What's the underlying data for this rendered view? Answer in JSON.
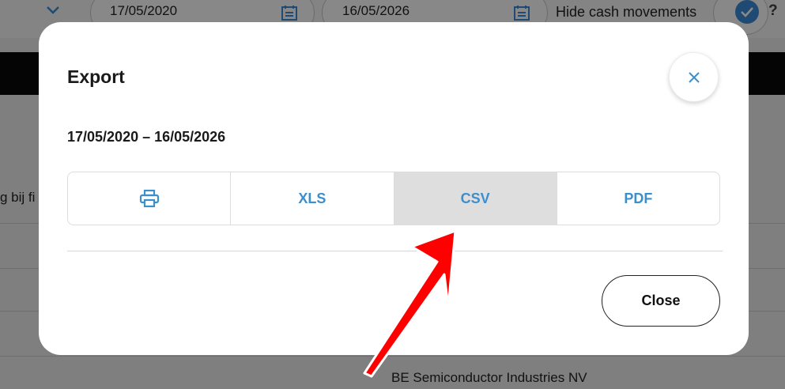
{
  "background": {
    "start_date": "17/05/2020",
    "end_date": "16/05/2026",
    "hide_cash_label": "Hide cash movements",
    "help_icon": "?",
    "left_cut_text": "g bij fi",
    "company_name": "BE Semiconductor Industries NV"
  },
  "modal": {
    "title": "Export",
    "date_range": "17/05/2020 – 16/05/2026",
    "options": [
      {
        "label": "",
        "icon": "printer-icon"
      },
      {
        "label": "XLS"
      },
      {
        "label": "CSV",
        "selected": true
      },
      {
        "label": "PDF"
      }
    ],
    "close_label": "Close"
  },
  "colors": {
    "accent": "#3d8fcc",
    "selected_bg": "#dedede",
    "annotation_arrow": "#ff0000"
  }
}
